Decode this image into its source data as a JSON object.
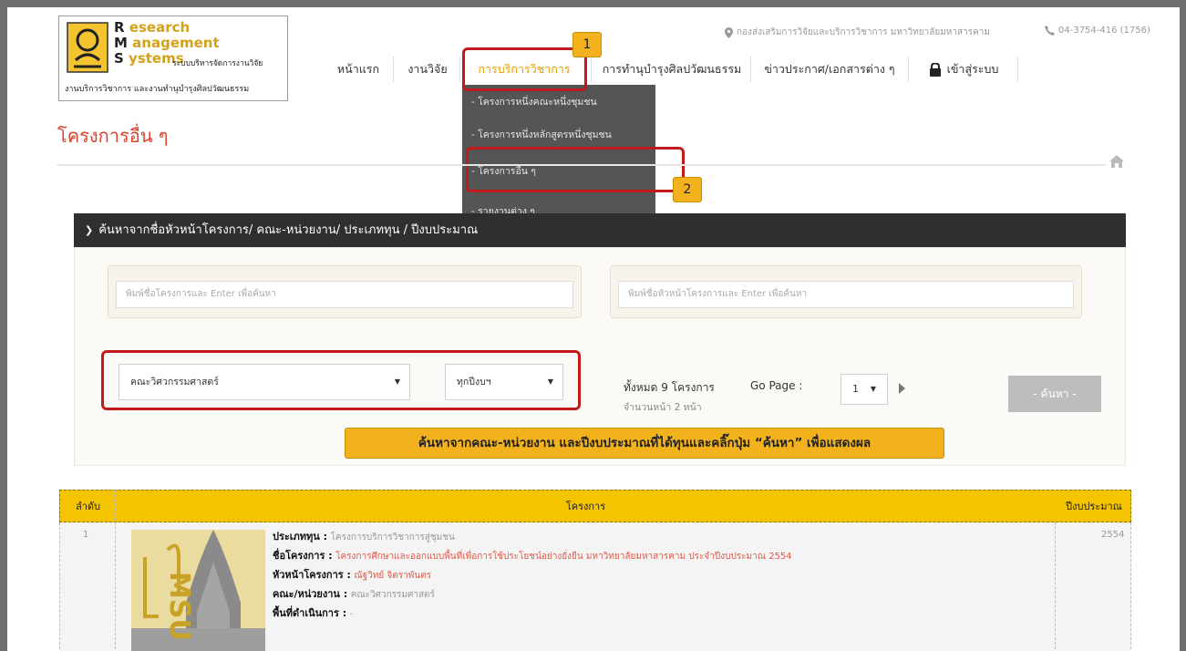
{
  "logo": {
    "word1": "esearch",
    "word2": "anagement",
    "word3": "ystems",
    "tagline": "ระบบบริหารจัดการงานวิจัย",
    "subtitle": "งานบริการวิชาการ และงานทำนุบำรุงศิลปวัฒนธรรม"
  },
  "topbar": {
    "location": "กองส่งเสริมการวิจัยและบริการวิชาการ มหาวิทยาลัยมหาสารคาม",
    "phone": "04-3754-416 (1756)"
  },
  "menu": {
    "items": [
      {
        "label": "หน้าแรก"
      },
      {
        "label": "งานวิจัย"
      },
      {
        "label": "การบริการวิชาการ"
      },
      {
        "label": "การทำนุบำรุงศิลปวัฒนธรรม"
      },
      {
        "label": "ข่าวประกาศ/เอกสารต่าง ๆ"
      },
      {
        "label": "เข้าสู่ระบบ"
      }
    ],
    "dropdown": [
      {
        "label": "- โครงการหนึ่งคณะหนึ่งชุมชน"
      },
      {
        "label": "- โครงการหนึ่งหลักสูตรหนึ่งชุมชน"
      },
      {
        "label": "- โครงการอื่น ๆ"
      },
      {
        "label": "- รายงานต่าง ๆ"
      }
    ]
  },
  "steps": {
    "one": "1",
    "two": "2"
  },
  "page_title": "โครงการอื่น ๆ",
  "search": {
    "bar_label": "ค้นหาจากชื่อหัวหน้าโครงการ/ คณะ-หน่วยงาน/ ประเภททุน / ปีงบประมาณ",
    "project_placeholder": "พิมพ์ชื่อโครงการและ Enter เพื่อค้นหา",
    "leader_placeholder": "พิมพ์ชื่อหัวหน้าโครงการและ Enter เพื่อค้นหา",
    "faculty_value": "คณะวิศวกรรมศาสตร์",
    "year_value": "ทุกปีงบฯ",
    "total_text": "ทั้งหมด 9 โครงการ",
    "pages_text": "จำนวนหน้า 2 หน้า",
    "goto_label": "Go Page :",
    "page_value": "1",
    "button_label": "- ค้นหา -",
    "callout": "ค้นหาจากคณะ-หน่วยงาน และปีงบประมาณที่ได้ทุนและคลิ๊กปุ่ม “ค้นหา” เพื่อแสดงผล"
  },
  "table": {
    "headers": [
      "ลำดับ",
      "โครงการ",
      "ปีงบประมาณ"
    ],
    "rows": [
      {
        "index": "1",
        "thumb_text": "MSU",
        "fund_label": "ประเภททุน :",
        "fund_value": "โครงการบริการวิชาการสู่ชุมชน",
        "name_label": "ชื่อโครงการ :",
        "name_value": "โครงการศึกษาและออกแบบพื้นที่เพื่อการใช้ประโยชน์อย่างยั่งยืน มหาวิทยาลัยมหาสารคาม ประจำปีงบประมาณ 2554",
        "leader_label": "หัวหน้าโครงการ :",
        "leader_value": "ณัฐวิทย์ จิตราพันตร",
        "faculty_label": "คณะ/หน่วยงาน :",
        "faculty_value": "คณะวิศวกรรมศาสตร์",
        "area_label": "พื้นที่ดำเนินการ :",
        "area_value": "-",
        "year": "2554"
      }
    ]
  },
  "colors": {
    "accent": "#f2b21e",
    "title": "#d8432e",
    "highlight": "#c21a1a",
    "header_yellow": "#f5c400"
  }
}
